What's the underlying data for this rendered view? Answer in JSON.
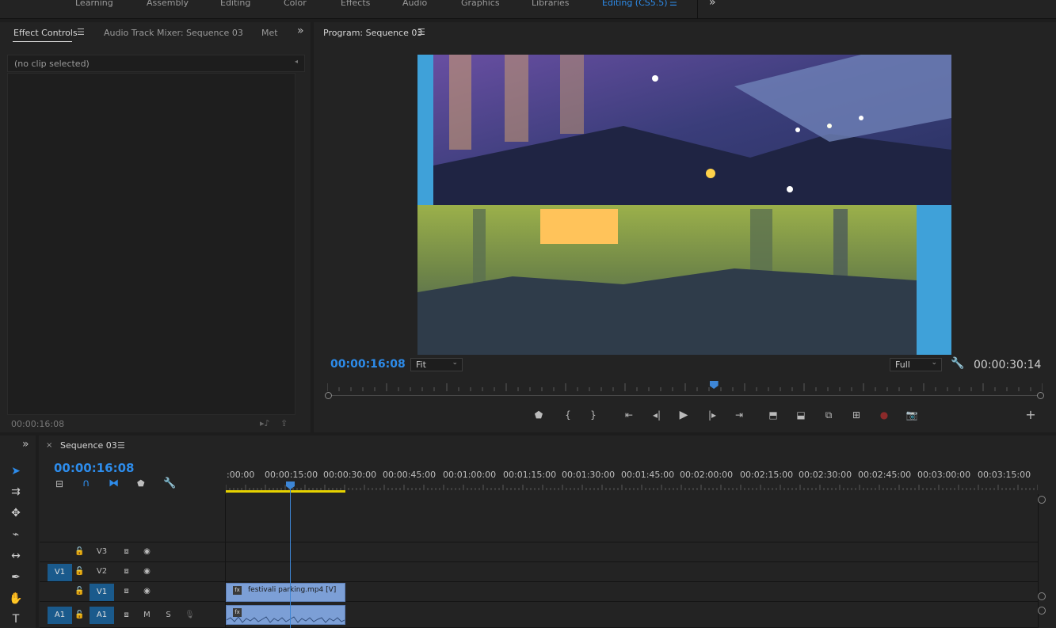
{
  "workspaces": {
    "items": [
      "Learning",
      "Assembly",
      "Editing",
      "Color",
      "Effects",
      "Audio",
      "Graphics",
      "Libraries",
      "Editing (CS5.5)"
    ],
    "overflow_icon": "double-chevron-right-icon"
  },
  "effect_controls": {
    "tabs": [
      "Effect Controls",
      "Audio Track Mixer: Sequence 03",
      "Met"
    ],
    "no_clip": "(no clip selected)",
    "timecode": "00:00:16:08"
  },
  "program": {
    "title": "Program: Sequence 03",
    "current_time": "00:00:16:08",
    "fit": "Fit",
    "resolution": "Full",
    "duration": "00:00:30:14",
    "playhead_fraction": 0.54
  },
  "timeline": {
    "sequence_name": "Sequence 03",
    "timecode": "00:00:16:08",
    "ruler_labels": [
      ":00:00",
      "00:00:15:00",
      "00:00:30:00",
      "00:00:45:00",
      "00:01:00:00",
      "00:01:15:00",
      "00:01:30:00",
      "00:01:45:00",
      "00:02:00:00",
      "00:02:15:00",
      "00:02:30:00",
      "00:02:45:00",
      "00:03:00:00",
      "00:03:15:00"
    ],
    "tracks": [
      {
        "name": "V3",
        "target": "",
        "selected": false
      },
      {
        "name": "V2",
        "target": "V1",
        "selected": false
      },
      {
        "name": "V1",
        "target": "",
        "selected": true
      },
      {
        "name": "A1",
        "target": "A1",
        "selected": true,
        "m": "M",
        "s": "S"
      }
    ],
    "clip_label": "festivali parking.mp4 [V]",
    "fx_badge": "fx"
  },
  "colors": {
    "accent": "#2d8ceb",
    "clip": "#7c9fd6",
    "work_area": "#e6d200",
    "playhead": "#3d86d6"
  }
}
